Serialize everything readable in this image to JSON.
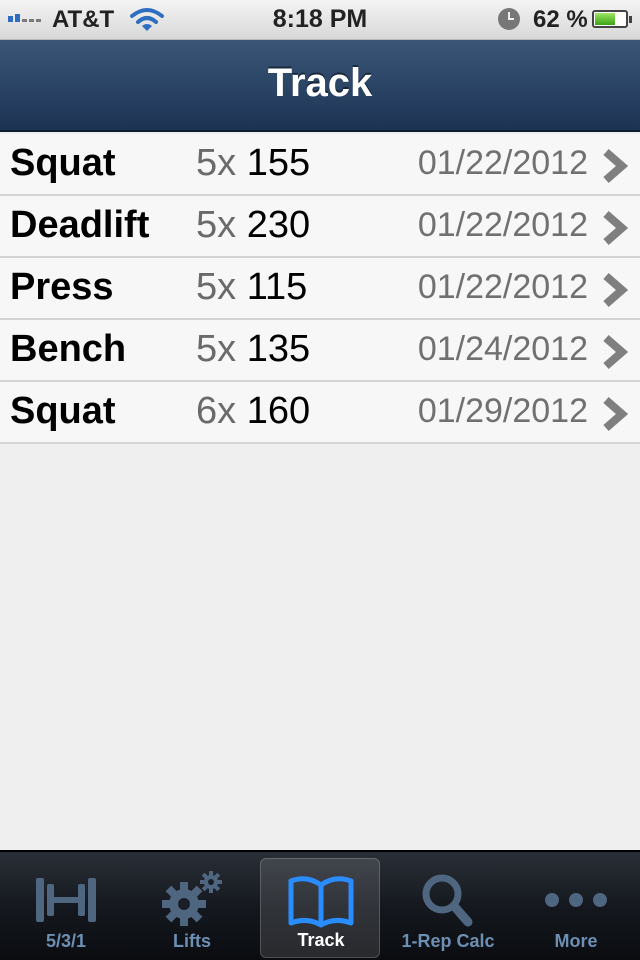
{
  "status_bar": {
    "carrier": "AT&T",
    "time": "8:18 PM",
    "battery_percent": "62 %",
    "battery_level": 0.62
  },
  "nav": {
    "title": "Track"
  },
  "rows": [
    {
      "lift": "Squat",
      "reps": "5x",
      "weight": "155",
      "date": "01/22/2012"
    },
    {
      "lift": "Deadlift",
      "reps": "5x",
      "weight": "230",
      "date": "01/22/2012"
    },
    {
      "lift": "Press",
      "reps": "5x",
      "weight": "115",
      "date": "01/22/2012"
    },
    {
      "lift": "Bench",
      "reps": "5x",
      "weight": "135",
      "date": "01/24/2012"
    },
    {
      "lift": "Squat",
      "reps": "6x",
      "weight": "160",
      "date": "01/29/2012"
    }
  ],
  "tab_bar": {
    "active": "Track",
    "tabs": [
      {
        "label": "5/3/1",
        "icon": "dumbbell-icon"
      },
      {
        "label": "Lifts",
        "icon": "gears-icon"
      },
      {
        "label": "Track",
        "icon": "book-icon"
      },
      {
        "label": "1-Rep Calc",
        "icon": "magnifier-icon"
      },
      {
        "label": "More",
        "icon": "more-dots-icon"
      }
    ]
  },
  "colors": {
    "nav_bar": "#2b4566",
    "tab_inactive": "#6d8fb4",
    "tab_active_icon": "#2a8dff",
    "battery_fill": "#4cbf1e"
  }
}
